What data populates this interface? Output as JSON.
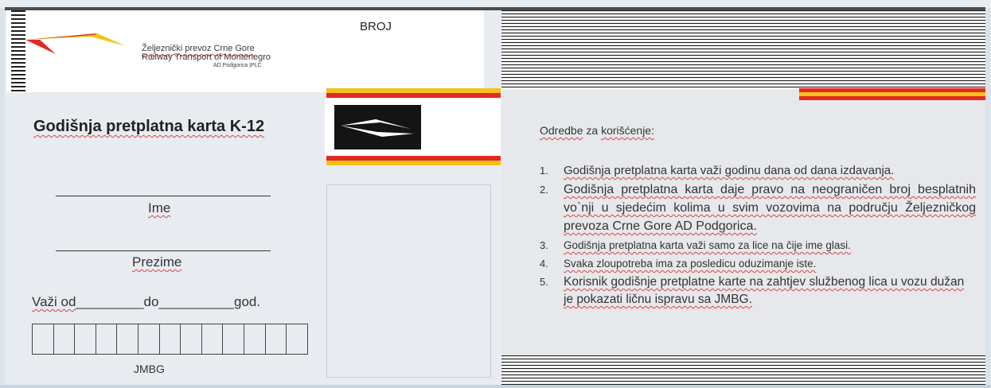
{
  "header": {
    "company_line1": "Željeznički prevoz Crne Gore",
    "company_line2": "Railway Transport of Montenegro",
    "company_line3": "AD Podgorica |PLC",
    "number_label": "BROJ"
  },
  "card": {
    "title": "Godišnja pretplatna karta K-12",
    "first_name_label": "Ime",
    "last_name_label": "Prezime",
    "valid_from_label": "Važi od",
    "valid_from_blank": "_________",
    "valid_to_label": "do",
    "valid_to_blank": "__________",
    "year_suffix": "god.",
    "id_label": "JMBG",
    "id_cells": 13
  },
  "rules": {
    "heading_word1": "Odredbe",
    "heading_word2": "za",
    "heading_word3": "korišćenje:",
    "items": [
      {
        "num": "1.",
        "text": "Godišnja pretplatna karta važi godinu dana od dana izdavanja."
      },
      {
        "num": "2.",
        "text": "Godišnja pretplatna karta daje pravo na neograničen broj besplatnih vo`nji u sjedećim kolima u svim vozovima na području Željezničkog prevoza Crne Gore AD Podgorica."
      },
      {
        "num": "3.",
        "text": "Godišnja pretplatna karta važi samo za lice na čije ime glasi."
      },
      {
        "num": "4.",
        "text": "Svaka zloupotreba ima za posledicu oduzimanje iste."
      },
      {
        "num": "5.",
        "text": "Korisnik godišnje pretplatne karte na zahtjev službenog lica u vozu dužan je pokazati ličnu ispravu sa JMBG."
      }
    ]
  },
  "colors": {
    "brand_red": "#e02a24",
    "brand_yellow": "#f2c21b",
    "card_background": "#e8ecf0"
  },
  "icons": {
    "company_logo": "zps-red-yellow-swoosh-logo",
    "badge_logo": "white-swoosh-logo-on-black"
  }
}
